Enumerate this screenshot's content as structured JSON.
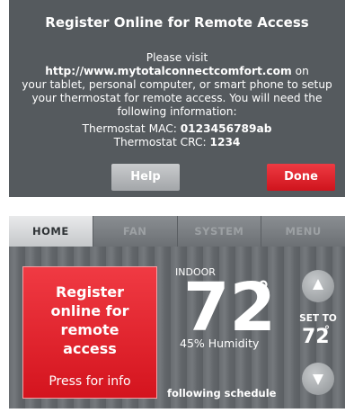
{
  "dialog": {
    "title": "Register Online for Remote Access",
    "line1_prefix": "Please visit ",
    "url": "http://www.mytotalconnectcomfort.com",
    "line1_suffix": " on",
    "line2": "your tablet, personal computer, or smart phone to setup",
    "line3": "your thermostat for remote access.  You will need the",
    "line4": "following information:",
    "mac_label": "Thermostat MAC: ",
    "mac_value": "0123456789ab",
    "crc_label": "Thermostat CRC: ",
    "crc_value": "1234",
    "help_label": "Help",
    "done_label": "Done",
    "colors": {
      "background": "#555a5e",
      "done": "#e3202a",
      "help": "#b5b8bb"
    }
  },
  "home": {
    "tabs": [
      "HOME",
      "FAN",
      "SYSTEM",
      "MENU"
    ],
    "active_tab": "HOME",
    "register": {
      "line1": "Register",
      "line2": "online for",
      "line3": "remote",
      "line4": "access",
      "info": "Press for info"
    },
    "indoor_label": "INDOOR",
    "indoor_temp": "72",
    "degree_symbol": "°",
    "humidity": "45% Humidity",
    "set_to_label": "SET TO",
    "set_to_value": "72",
    "schedule_text": "following schedule",
    "icons": [
      "up-arrow-icon",
      "down-arrow-icon"
    ],
    "colors": {
      "background": "#5e6266",
      "register": "#e3202a",
      "text": "#ffffff"
    }
  }
}
